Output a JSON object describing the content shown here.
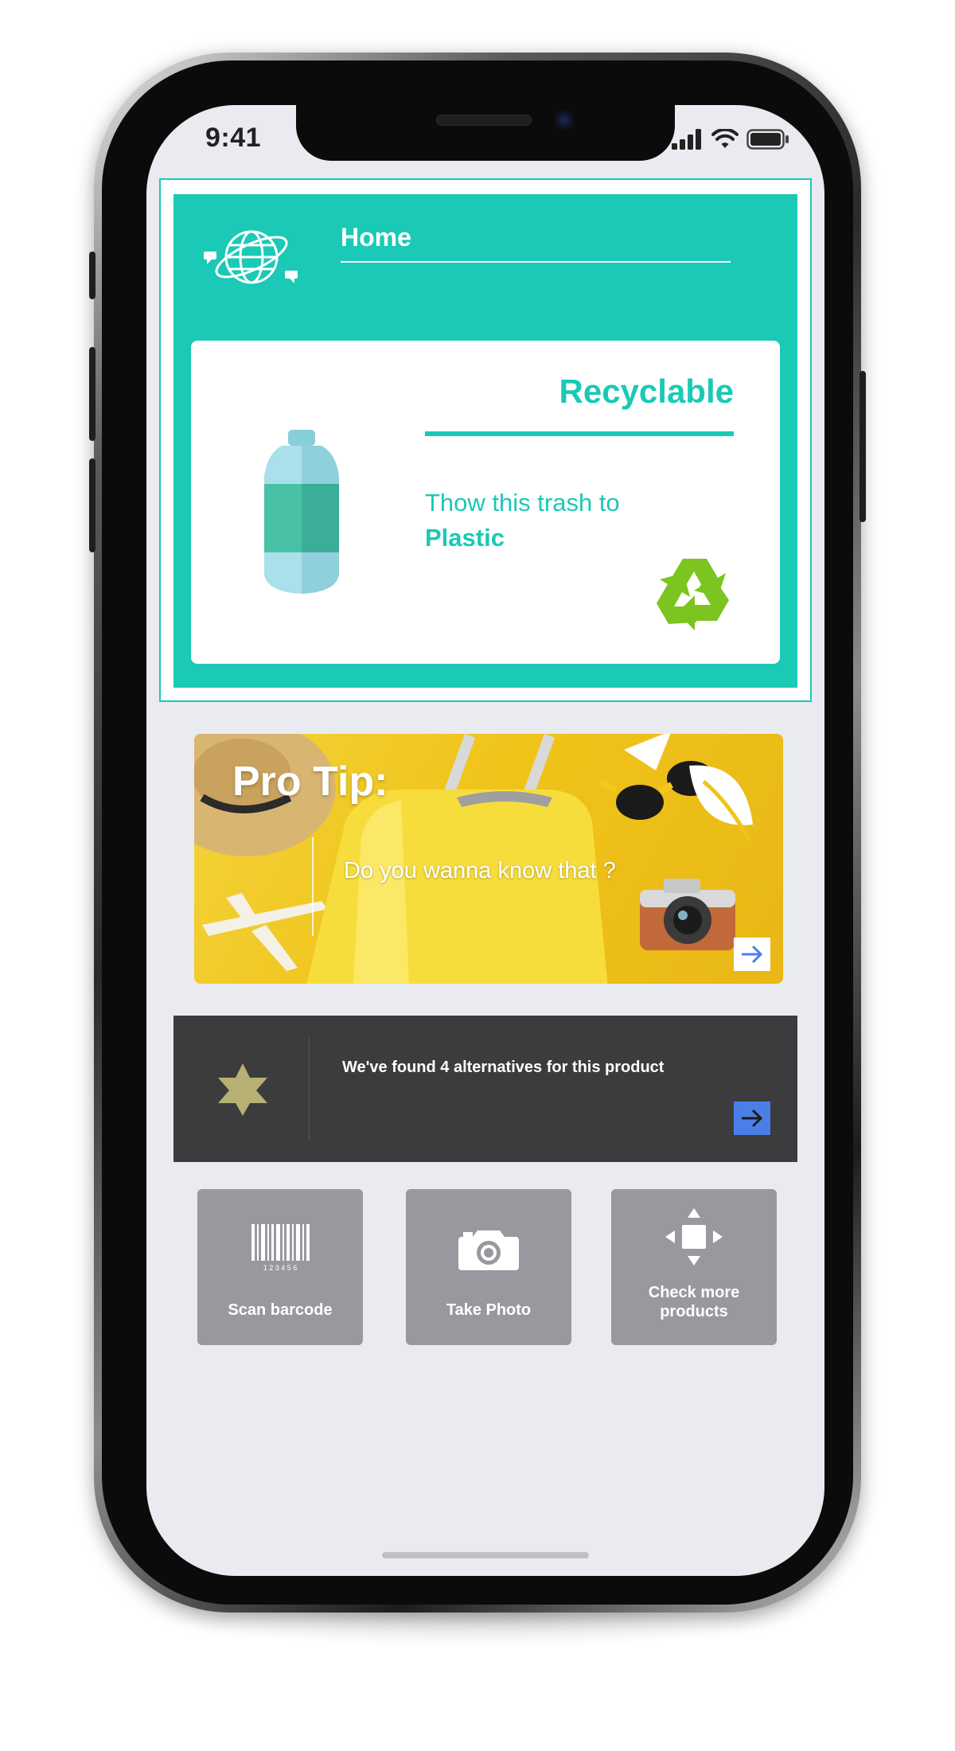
{
  "status_bar": {
    "time": "9:41"
  },
  "header": {
    "title": "Home"
  },
  "result": {
    "title": "Recyclable",
    "instruction": "Thow this trash to",
    "category": "Plastic",
    "icons": {
      "item": "bottle-icon",
      "badge": "recycle-icon"
    }
  },
  "pro_tip": {
    "title": "Pro Tip:",
    "subtitle": "Do you wanna know that ?",
    "icons": {
      "badge": "leaf-icon",
      "action": "arrow-right-icon"
    }
  },
  "alternatives": {
    "text": "We've found 4 alternatives for this product",
    "icons": {
      "badge": "star-icon",
      "action": "arrow-right-icon"
    }
  },
  "actions": [
    {
      "label": "Scan barcode",
      "icon": "barcode-icon",
      "barcode_digits": "1 2 3 4 5 6"
    },
    {
      "label": "Take Photo",
      "icon": "camera-icon"
    },
    {
      "label": "Check more products",
      "icon": "directional-pad-icon"
    }
  ],
  "colors": {
    "accent": "#1ac9b6",
    "screen_bg": "#eaebf0",
    "dark_bar": "#3c3c3e",
    "action_bg": "#98999e",
    "link_blue": "#4c7ee8",
    "recycle_green": "#7cc41f"
  }
}
